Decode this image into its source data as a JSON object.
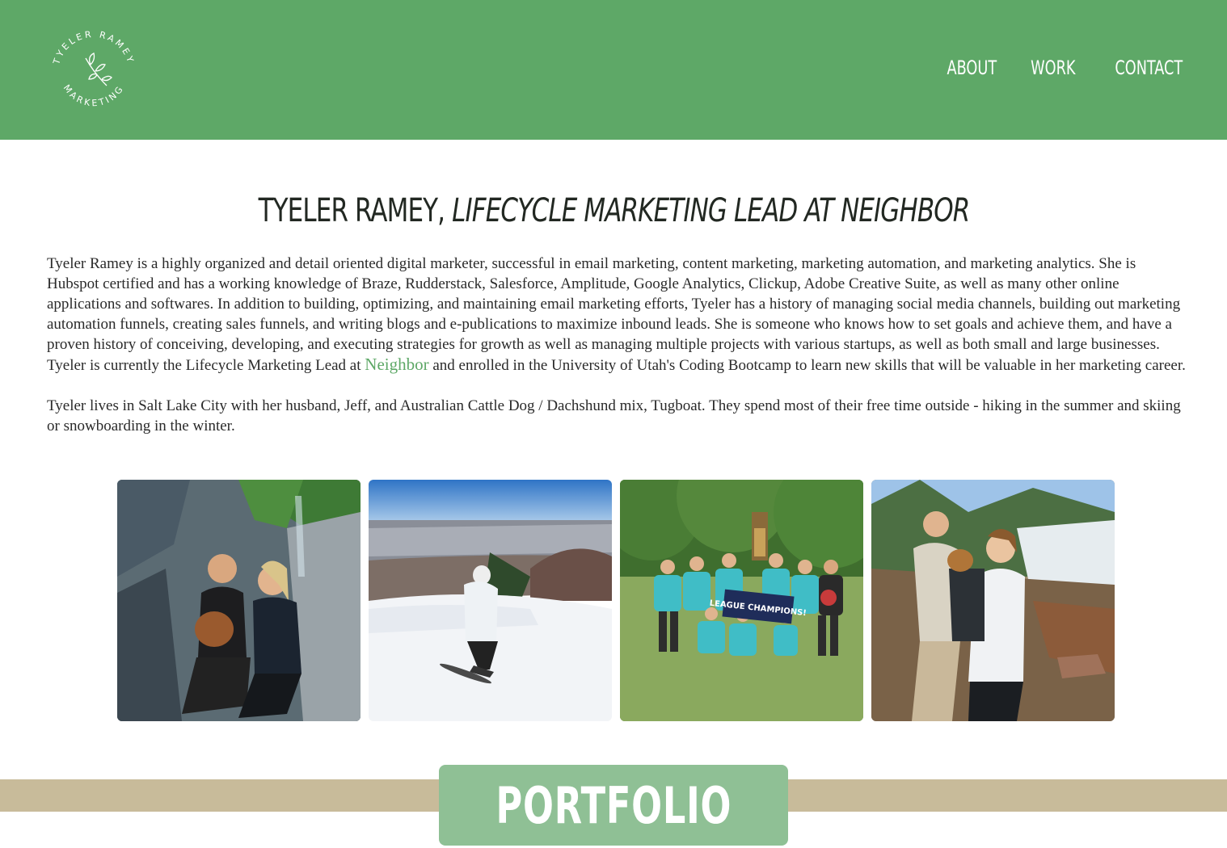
{
  "header": {
    "logo_text_top": "TYELER RAMEY",
    "logo_text_bottom": "MARKETING",
    "nav": [
      "ABOUT",
      "WORK",
      "CONTACT"
    ],
    "bg_color": "#5ea867"
  },
  "main": {
    "title_name": "TYELER RAMEY,",
    "title_role": "LIFECYCLE MARKETING LEAD AT NEIGHBOR",
    "bio_p1_before": "Tyeler Ramey is a highly organized and detail oriented digital marketer, successful in email marketing, content marketing, marketing automation, and marketing analytics. She is Hubspot certified and has a working knowledge of Braze, Rudderstack, Salesforce, Amplitude, Google Analytics, Clickup, Adobe Creative Suite, as well as many other online applications and softwares. In addition to building, optimizing, and maintaining email marketing efforts, Tyeler has a history of managing social media channels, building out marketing automation funnels, creating sales funnels, and writing blogs and e-publications to maximize inbound leads. She is someone who knows how to set goals and achieve them, and have a proven history of conceiving, developing, and executing strategies for growth as well as managing multiple projects with various startups, as well as both small and large businesses. Tyeler is currently the Lifecycle Marketing Lead at ",
    "bio_link": "Neighbor",
    "bio_p1_after": " and enrolled in the University of Utah's Coding Bootcamp to learn new skills that will be valuable in her marketing career.",
    "bio_p2": "Tyeler lives in Salt Lake City with her husband, Jeff, and Australian Cattle Dog / Dachshund mix, Tugboat. They spend most of their free time outside - hiking in the summer and skiing or snowboarding in the winter.",
    "photos": [
      {
        "name": "hiking-photo"
      },
      {
        "name": "snowboarding-photo"
      },
      {
        "name": "league-champions-photo",
        "banner_text": "LEAGUE CHAMPIONS!"
      },
      {
        "name": "dog-backpack-photo"
      }
    ]
  },
  "footer": {
    "portfolio_label": "PORTFOLIO",
    "band_color": "#c8bb9a"
  }
}
